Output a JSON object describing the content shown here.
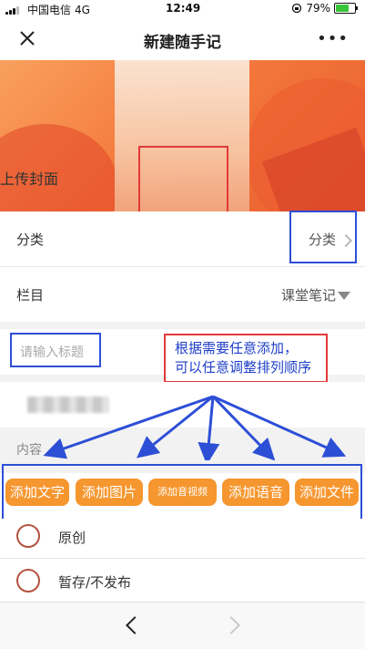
{
  "status_bar": {
    "carrier": "中国电信",
    "network": "4G",
    "time": "12:49",
    "battery": "79%",
    "battery_level": 0.79
  },
  "nav": {
    "title": "新建随手记",
    "more": "•••"
  },
  "cover": {
    "upload_label": "上传封面"
  },
  "category": {
    "label": "分类",
    "value": "分类"
  },
  "column": {
    "label": "栏目",
    "value": "课堂笔记"
  },
  "title_input": {
    "placeholder": "请输入标题"
  },
  "content": {
    "label": "内容",
    "buttons": [
      "添加文字",
      "添加图片",
      "添加音视频",
      "添加语音",
      "添加文件"
    ]
  },
  "options": {
    "original": "原创",
    "draft": "暂存/不发布"
  },
  "annotation": {
    "line1": "根据需要任意添加，",
    "line2": "可以任意调整排列顺序"
  },
  "colors": {
    "accent_orange": "#f6962e",
    "annotation_blue": "#2d4fd6",
    "annotation_red": "#e33939"
  }
}
